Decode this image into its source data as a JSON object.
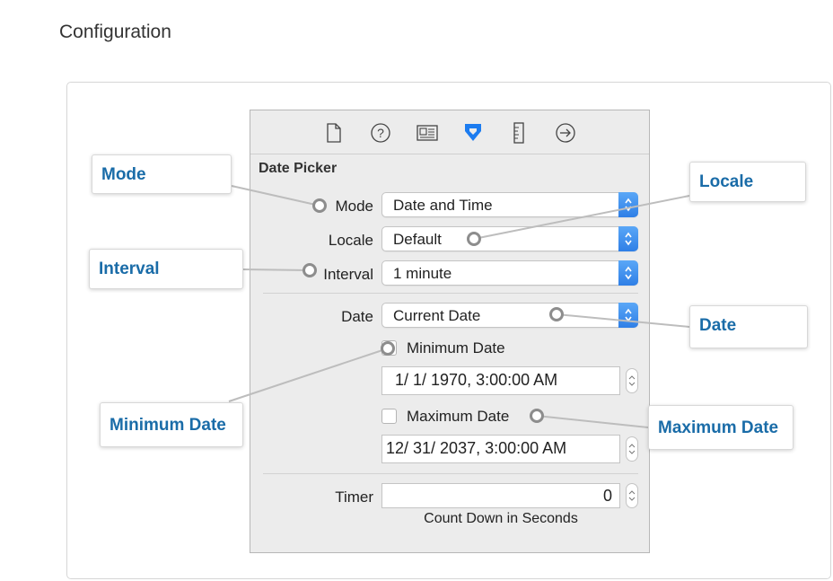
{
  "page": {
    "title": "Configuration"
  },
  "inspector": {
    "toolbar": {
      "icons": [
        "file-icon",
        "help-icon",
        "identity-icon",
        "attributes-icon",
        "size-icon",
        "connections-icon"
      ],
      "active_color": "#1c7cf0"
    },
    "section_title": "Date Picker",
    "mode": {
      "label": "Mode",
      "value": "Date and Time"
    },
    "locale": {
      "label": "Locale",
      "value": "Default"
    },
    "interval": {
      "label": "Interval",
      "value": "1 minute"
    },
    "date": {
      "label": "Date",
      "value": "Current Date"
    },
    "minimum_date": {
      "label": "Minimum Date",
      "value": "1/  1/ 1970,  3:00:00 AM"
    },
    "maximum_date": {
      "label": "Maximum Date",
      "value": "12/ 31/ 2037,  3:00:00 AM"
    },
    "timer": {
      "label": "Timer",
      "value": "0",
      "caption": "Count Down in Seconds"
    }
  },
  "callouts": {
    "mode": "Mode",
    "interval": "Interval",
    "minimum_date": "Minimum Date",
    "locale": "Locale",
    "date": "Date",
    "maximum_date": "Maximum Date"
  },
  "colors": {
    "callout_text": "#1a6ca8",
    "accent": "#1c7cf0"
  }
}
